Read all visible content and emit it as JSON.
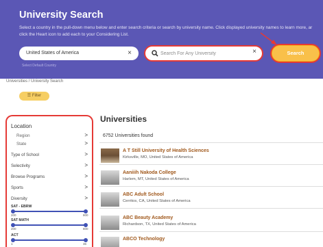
{
  "header": {
    "title": "University Search",
    "description_line1": "Select a country in the pull-down menu below and enter search criteria or search by university name. Click displayed university names to learn more, ar",
    "description_line2": "click the Heart icon to add each to your Considering List.",
    "country_value": "United States of America",
    "default_country_label": "Select Default Country",
    "search_placeholder": "Search For Any University",
    "search_button": "Search",
    "clear_glyph": "×",
    "search_icon": "search-icon"
  },
  "breadcrumb": "Universities / University Search",
  "filter_button": "☰ Filter",
  "sidebar": {
    "title": "Location",
    "location_items": [
      "Region",
      "State"
    ],
    "categories": [
      "Type of School",
      "Selectivity",
      "Browse Programs",
      "Sports",
      "Diversity"
    ],
    "chevron": ">",
    "ranges": [
      {
        "label": "SAT - EBRW",
        "min": "200",
        "max": "800"
      },
      {
        "label": "SAT MATH",
        "min": "200",
        "max": "800"
      },
      {
        "label": "ACT",
        "min": "1",
        "max": "36"
      }
    ]
  },
  "main": {
    "title": "Universities",
    "found_text": "6752 Universities found",
    "universities": [
      {
        "name": "A T Still University of Health Sciences",
        "location": "Kirksville, MO, United States of America"
      },
      {
        "name": "Aaniiih Nakoda College",
        "location": "Harlem, MT, United States of America"
      },
      {
        "name": "ABC Adult School",
        "location": "Cerritos, CA, United States of America"
      },
      {
        "name": "ABC Beauty Academy",
        "location": "Richardson, TX, United States of America"
      },
      {
        "name": "ABCO Technology",
        "location": ""
      }
    ]
  },
  "colors": {
    "header_bg": "#5b57b5",
    "accent_yellow": "#f6b51b",
    "highlight_red": "#e53935",
    "link_brown": "#a0581b",
    "slider_blue": "#3f51b5"
  }
}
